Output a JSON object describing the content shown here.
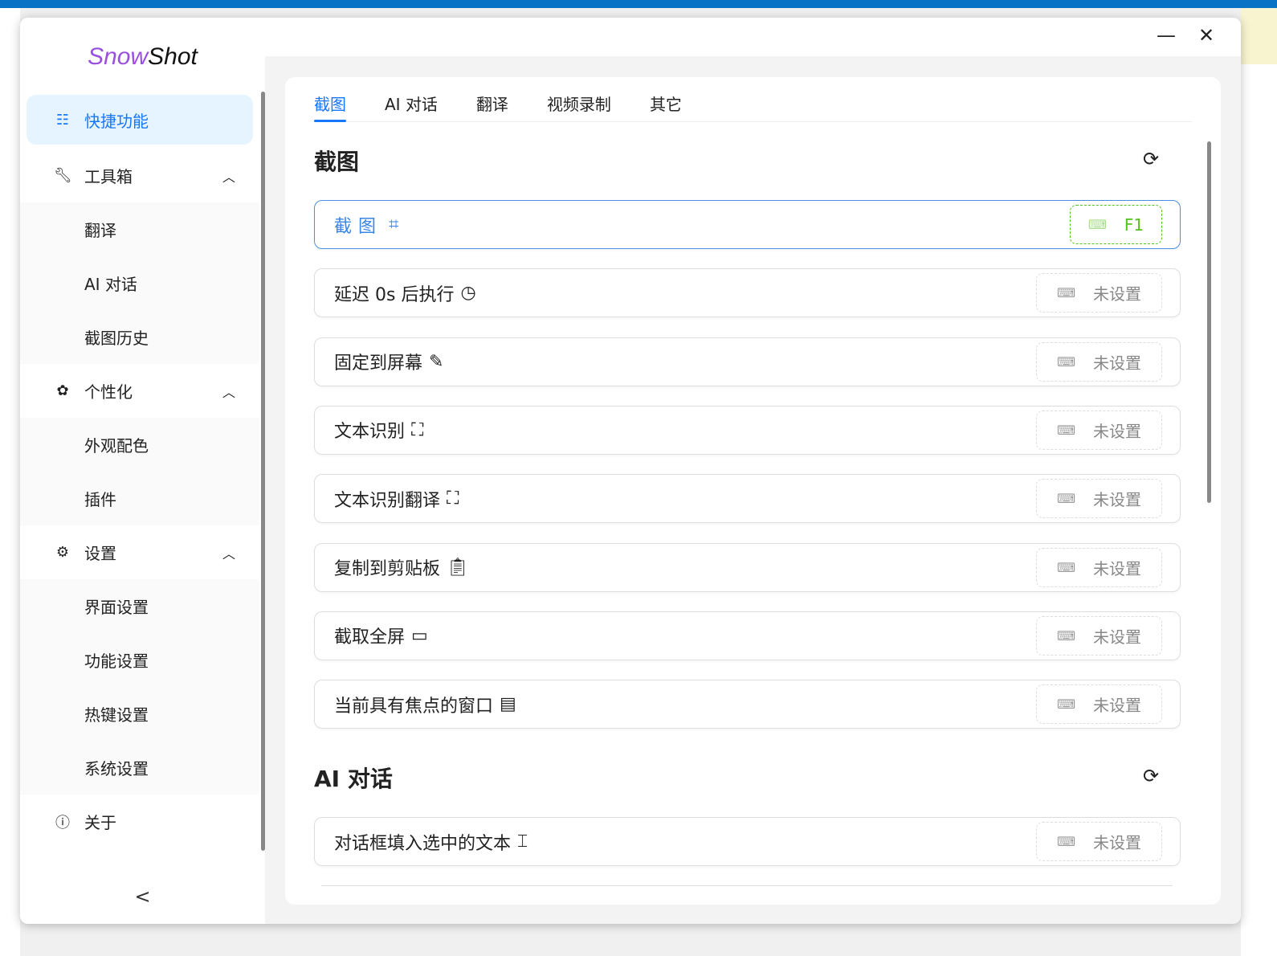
{
  "app": {
    "logo_a": "Snow",
    "logo_b": "Shot",
    "minimize": "—",
    "close": "✕"
  },
  "sidebar": {
    "quick": "快捷功能",
    "toolbox": "工具箱",
    "toolbox_items": [
      "翻译",
      "AI 对话",
      "截图历史"
    ],
    "personal": "个性化",
    "personal_items": [
      "外观配色",
      "插件"
    ],
    "settings": "设置",
    "settings_items": [
      "界面设置",
      "功能设置",
      "热键设置",
      "系统设置"
    ],
    "about": "关于",
    "collapse": "<"
  },
  "tabs": [
    "截图",
    "AI 对话",
    "翻译",
    "视频录制",
    "其它"
  ],
  "screenshot": {
    "title": "截图",
    "rows": [
      {
        "label": "截图",
        "icon": "crop-icon",
        "key": "F1"
      },
      {
        "label": "延迟 0s 后执行",
        "icon": "clock-icon",
        "key": "未设置"
      },
      {
        "label": "固定到屏幕",
        "icon": "pin-icon",
        "key": "未设置"
      },
      {
        "label": "文本识别",
        "icon": "ocr-icon",
        "key": "未设置"
      },
      {
        "label": "文本识别翻译",
        "icon": "translate-icon",
        "key": "未设置"
      },
      {
        "label": "复制到剪贴板",
        "icon": "clipboard-icon",
        "key": "未设置"
      },
      {
        "label": "截取全屏",
        "icon": "monitor-icon",
        "key": "未设置"
      },
      {
        "label": "当前具有焦点的窗口",
        "icon": "window-icon",
        "key": "未设置"
      }
    ]
  },
  "ai": {
    "title": "AI 对话",
    "rows": [
      {
        "label": "对话框填入选中的文本",
        "icon": "text-select-icon",
        "key": "未设置"
      }
    ]
  },
  "colors": {
    "accent": "#1677ff",
    "active_bg": "#e6f4ff",
    "success": "#52c41a",
    "logo": "#9b4fe0"
  }
}
